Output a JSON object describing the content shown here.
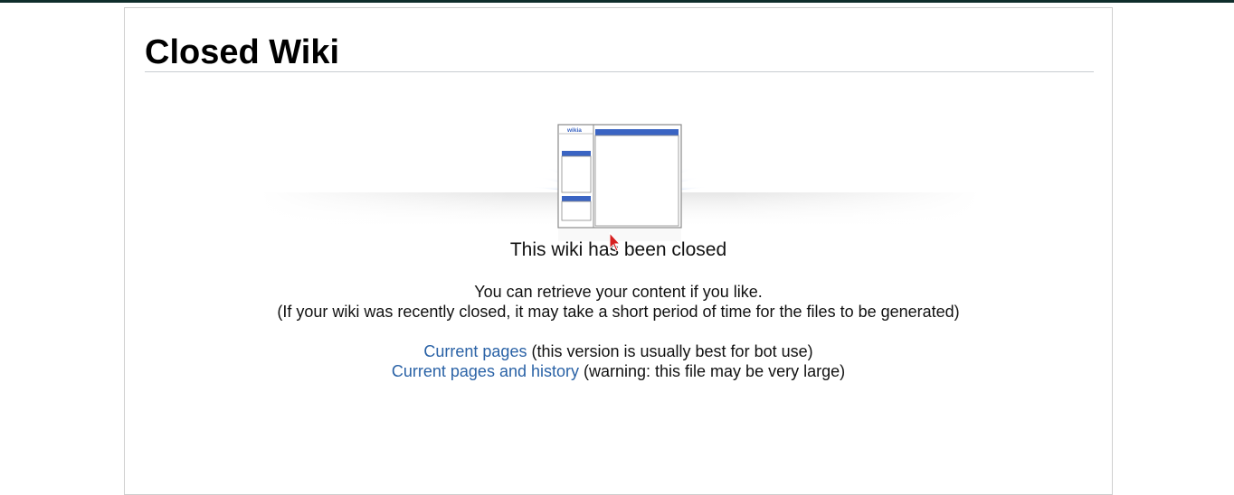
{
  "page": {
    "title": "Closed Wiki"
  },
  "illustration": {
    "logo_text": "wikia",
    "icon": "closed-wiki-illustration"
  },
  "content": {
    "heading": "This wiki has been closed",
    "retrieve_line": "You can retrieve your content if you like.",
    "note_line": "(If your wiki was recently closed, it may take a short period of time for the files to be generated)"
  },
  "downloads": [
    {
      "link_label": "Current pages",
      "note": " (this version is usually best for bot use)"
    },
    {
      "link_label": "Current pages and history",
      "note": " (warning: this file may be very large)"
    }
  ],
  "colors": {
    "link": "#2a62a6",
    "top_strip": "#0f2d2b",
    "accent_blue": "#3a64c3",
    "cursor": "#d62020"
  }
}
